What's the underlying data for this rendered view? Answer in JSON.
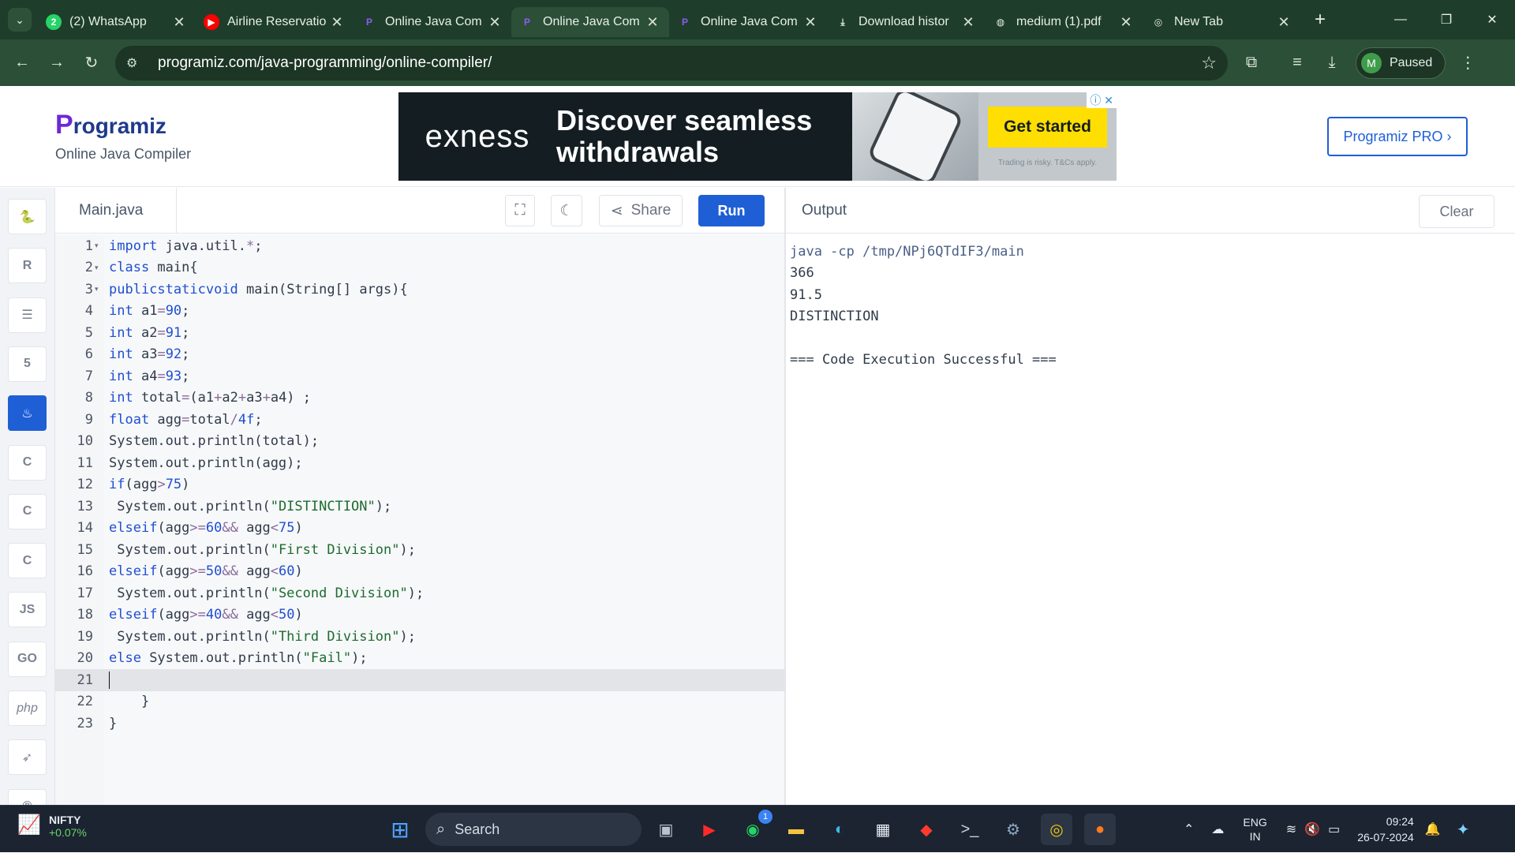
{
  "browser": {
    "tabs": [
      {
        "title": "(2) WhatsApp",
        "icon": "whatsapp-icon"
      },
      {
        "title": "Airline Reservatio",
        "icon": "youtube-icon"
      },
      {
        "title": "Online Java Com",
        "icon": "programiz-icon"
      },
      {
        "title": "Online Java Com",
        "icon": "programiz-icon"
      },
      {
        "title": "Online Java Com",
        "icon": "programiz-icon"
      },
      {
        "title": "Download histor",
        "icon": "download-icon"
      },
      {
        "title": "medium (1).pdf",
        "icon": "globe-icon"
      },
      {
        "title": "New Tab",
        "icon": "chrome-icon"
      }
    ],
    "active_tab_index": 3,
    "url": "programiz.com/java-programming/online-compiler/",
    "profile_initial": "M",
    "profile_status": "Paused"
  },
  "header": {
    "logo_text": "rogramiz",
    "logo_mark": "P",
    "subtitle": "Online Java Compiler",
    "pro_button": "Programiz PRO ›"
  },
  "ad": {
    "brand": "exness",
    "headline": "Discover seamless withdrawals",
    "cta": "Get started",
    "disclaimer": "Trading is risky. T&Cs apply."
  },
  "sidebar": {
    "languages": [
      "python-icon",
      "r-icon",
      "sql-icon",
      "html-icon",
      "java-icon",
      "c-icon",
      "cpp-icon",
      "csharp-icon",
      "JS",
      "GO",
      "php",
      "swift-icon",
      "rust-icon"
    ],
    "active_index": 4
  },
  "editor": {
    "filename": "Main.java",
    "share_label": "Share",
    "run_label": "Run",
    "current_line": 21,
    "lines": [
      "import java.util.*;",
      "class main{",
      "    public  static void main(String[] args){",
      "        int a1=90;",
      "int a2=91;",
      "int a3=92;",
      "int a4=93;",
      "int total=(a1+a2+a3+a4) ;",
      "float agg=total/4f;",
      "System.out.println(total);",
      "System.out.println(agg);",
      "if(agg>75)",
      " System.out.println(\"DISTINCTION\");",
      "else if(agg>=60 && agg<75)",
      " System.out.println(\"First Division\");",
      "else if(agg>=50 && agg<60)",
      " System.out.println(\"Second Division\");",
      "else if(agg>=40 && agg<50)",
      " System.out.println(\"Third Division\");",
      "else System.out.println(\"Fail\");",
      "",
      "    }",
      "}"
    ],
    "folds": [
      1,
      2,
      3
    ]
  },
  "output": {
    "title": "Output",
    "clear_label": "Clear",
    "lines": [
      "java -cp /tmp/NPj6QTdIF3/main",
      "366",
      "91.5",
      "DISTINCTION",
      "",
      "=== Code Execution Successful ==="
    ]
  },
  "taskbar": {
    "ticker_name": "NIFTY",
    "ticker_change": "+0.07%",
    "search_label": "Search",
    "whatsapp_badge": "1",
    "lang_top": "ENG",
    "lang_bottom": "IN",
    "time": "09:24",
    "date": "26-07-2024"
  }
}
